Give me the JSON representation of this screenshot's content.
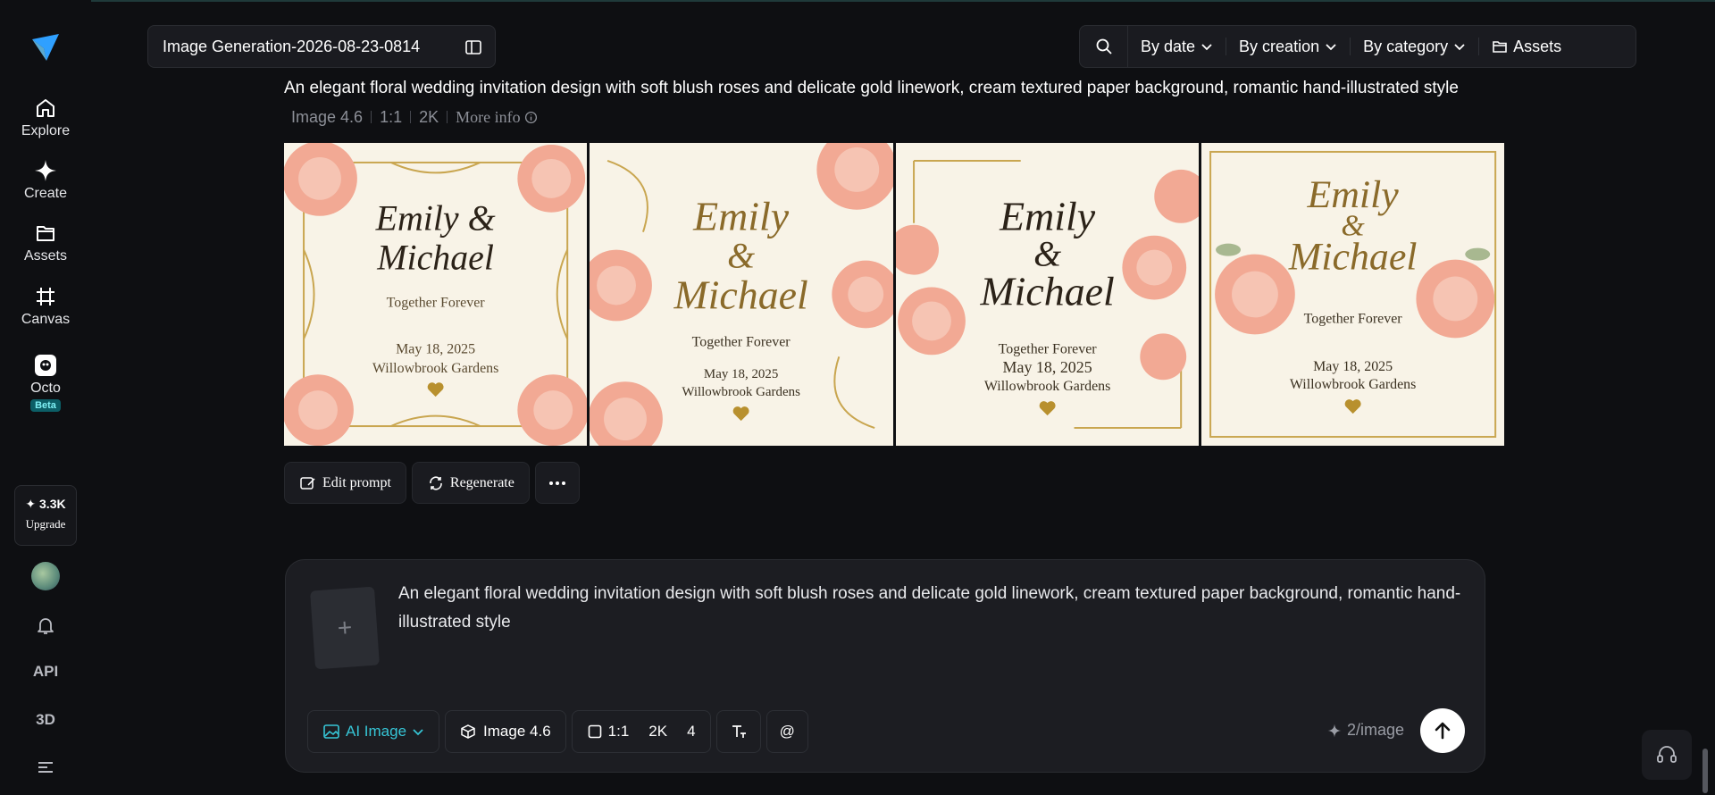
{
  "sidebar": {
    "items": [
      {
        "label": "Explore",
        "icon": "home-icon"
      },
      {
        "label": "Create",
        "icon": "sparkle-icon"
      },
      {
        "label": "Assets",
        "icon": "folder-icon"
      },
      {
        "label": "Canvas",
        "icon": "canvas-icon"
      },
      {
        "label": "Octo",
        "icon": "octo-icon",
        "badge": "Beta"
      }
    ],
    "credits": "3.3K",
    "upgrade_label": "Upgrade",
    "api_label": "API",
    "three_d_label": "3D"
  },
  "header": {
    "title": "Image Generation-2026-08-23-0814",
    "filters": [
      "By date",
      "By creation",
      "By category"
    ],
    "assets_label": "Assets"
  },
  "result": {
    "prompt": "An elegant floral wedding invitation design with soft blush roses and delicate gold linework, cream textured paper background, romantic hand-illustrated style",
    "model": "Image 4.6",
    "ratio": "1:1",
    "resolution": "2K",
    "more_info": "More info",
    "cards": [
      {
        "names": "Emily & Michael",
        "tagline": "Together Forever",
        "date": "May 18, 2025",
        "venue": "Willowbrook Gardens"
      },
      {
        "names": "Emily & Michael",
        "tagline": "Together Forever",
        "date": "May 18, 2025",
        "venue": "Willowbrook Gardens"
      },
      {
        "names": "Emily & Michael",
        "tagline": "Together Forever",
        "date": "May 18, 2025",
        "venue": "Willowbrook Gardens"
      },
      {
        "names": "Emily & Michael",
        "tagline": "Together Forever",
        "date": "May 18, 2025",
        "venue": "Willowbrook Gardens"
      }
    ],
    "actions": {
      "edit": "Edit prompt",
      "regenerate": "Regenerate"
    }
  },
  "composer": {
    "prompt": "An elegant floral wedding invitation design with soft blush roses and delicate gold linework, cream textured paper background, romantic hand-illustrated style",
    "mode": "AI Image",
    "model": "Image 4.6",
    "ratio": "1:1",
    "resolution": "2K",
    "count": "4",
    "mention": "@",
    "cost": "2/image"
  },
  "colors": {
    "accent": "#36c5d6",
    "gold": "#8a6a2a",
    "rose": "#f2a994",
    "paper": "#f7f2e6"
  }
}
